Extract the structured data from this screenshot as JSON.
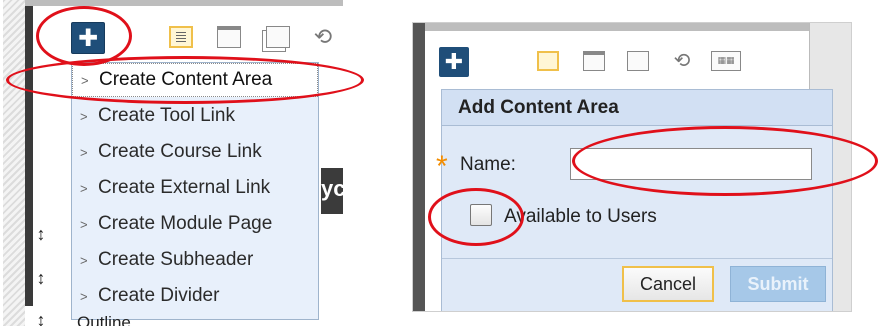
{
  "left_panel": {
    "toolbar": {
      "add_menu_glyph": "✚",
      "icons": [
        "list-view-icon",
        "folder-icon",
        "window-icon",
        "refresh-icon"
      ],
      "refresh_glyph": "⟲"
    },
    "menu_items": [
      {
        "label": "Create Content Area",
        "active": true
      },
      {
        "label": "Create Tool Link",
        "active": false
      },
      {
        "label": "Create Course Link",
        "active": false
      },
      {
        "label": "Create External Link",
        "active": false
      },
      {
        "label": "Create Module Page",
        "active": false
      },
      {
        "label": "Create Subheader",
        "active": false
      },
      {
        "label": "Create Divider",
        "active": false
      }
    ],
    "chevron_glyph": ">",
    "drag_arrow_glyph": "↕",
    "partial_text_right": "yc",
    "partial_text_bottom": "Outline"
  },
  "right_panel": {
    "toolbar": {
      "add_menu_glyph": "✚",
      "icons": [
        "list-view-icon",
        "folder-icon",
        "window-icon",
        "refresh-icon",
        "grid-icon"
      ],
      "refresh_glyph": "⟲",
      "grid_glyph": "▦▦"
    },
    "dialog": {
      "title": "Add Content Area",
      "required_star": "*",
      "name_label": "Name:",
      "name_value": "",
      "available_label": "Available to Users",
      "available_checked": false,
      "cancel_label": "Cancel",
      "submit_label": "Submit"
    }
  },
  "colors": {
    "accent_button": "#1f4e79",
    "highlight_ring": "#e0101a",
    "required_star": "#f28c00",
    "menu_bg": "#e8f0fb",
    "dialog_bg": "#dfe9f7"
  }
}
